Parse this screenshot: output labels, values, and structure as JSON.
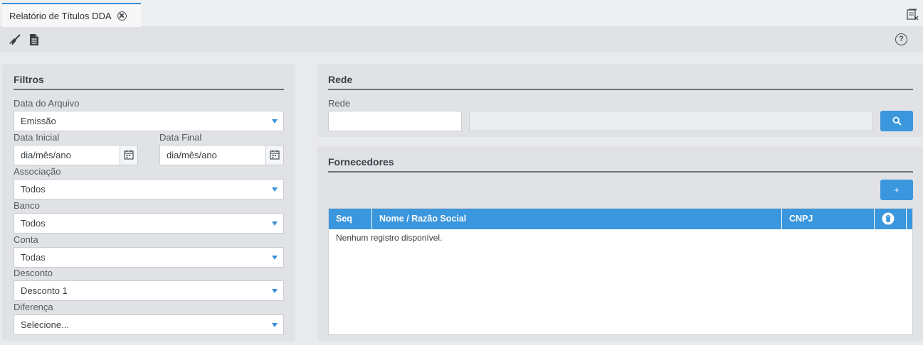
{
  "tab": {
    "title": "Relatório de Títulos DDA"
  },
  "toolbar": {
    "clear_icon": "broom-icon",
    "report_icon": "document-icon",
    "help_label": "?"
  },
  "filters": {
    "title": "Filtros",
    "data_arquivo": {
      "label": "Data do Arquivo",
      "value": "Emissão"
    },
    "data_inicial": {
      "label": "Data Inicial",
      "value": "dia/mês/ano"
    },
    "data_final": {
      "label": "Data Final",
      "value": "dia/mês/ano"
    },
    "associacao": {
      "label": "Associação",
      "value": "Todos"
    },
    "banco": {
      "label": "Banco",
      "value": "Todos"
    },
    "conta": {
      "label": "Conta",
      "value": "Todas"
    },
    "desconto": {
      "label": "Desconto",
      "value": "Desconto 1"
    },
    "diferenca": {
      "label": "Diferença",
      "value": "Selecione..."
    }
  },
  "rede": {
    "title": "Rede",
    "field_label": "Rede",
    "code_value": "",
    "name_value": ""
  },
  "fornecedores": {
    "title": "Fornecedores",
    "add_label": "+",
    "columns": [
      "Seq",
      "Nome / Razão Social",
      "CNPJ"
    ],
    "empty_message": "Nenhum registro disponível."
  },
  "colors": {
    "accent": "#3a96dd",
    "panel": "#e0e2e5",
    "background": "#e9eaec"
  }
}
